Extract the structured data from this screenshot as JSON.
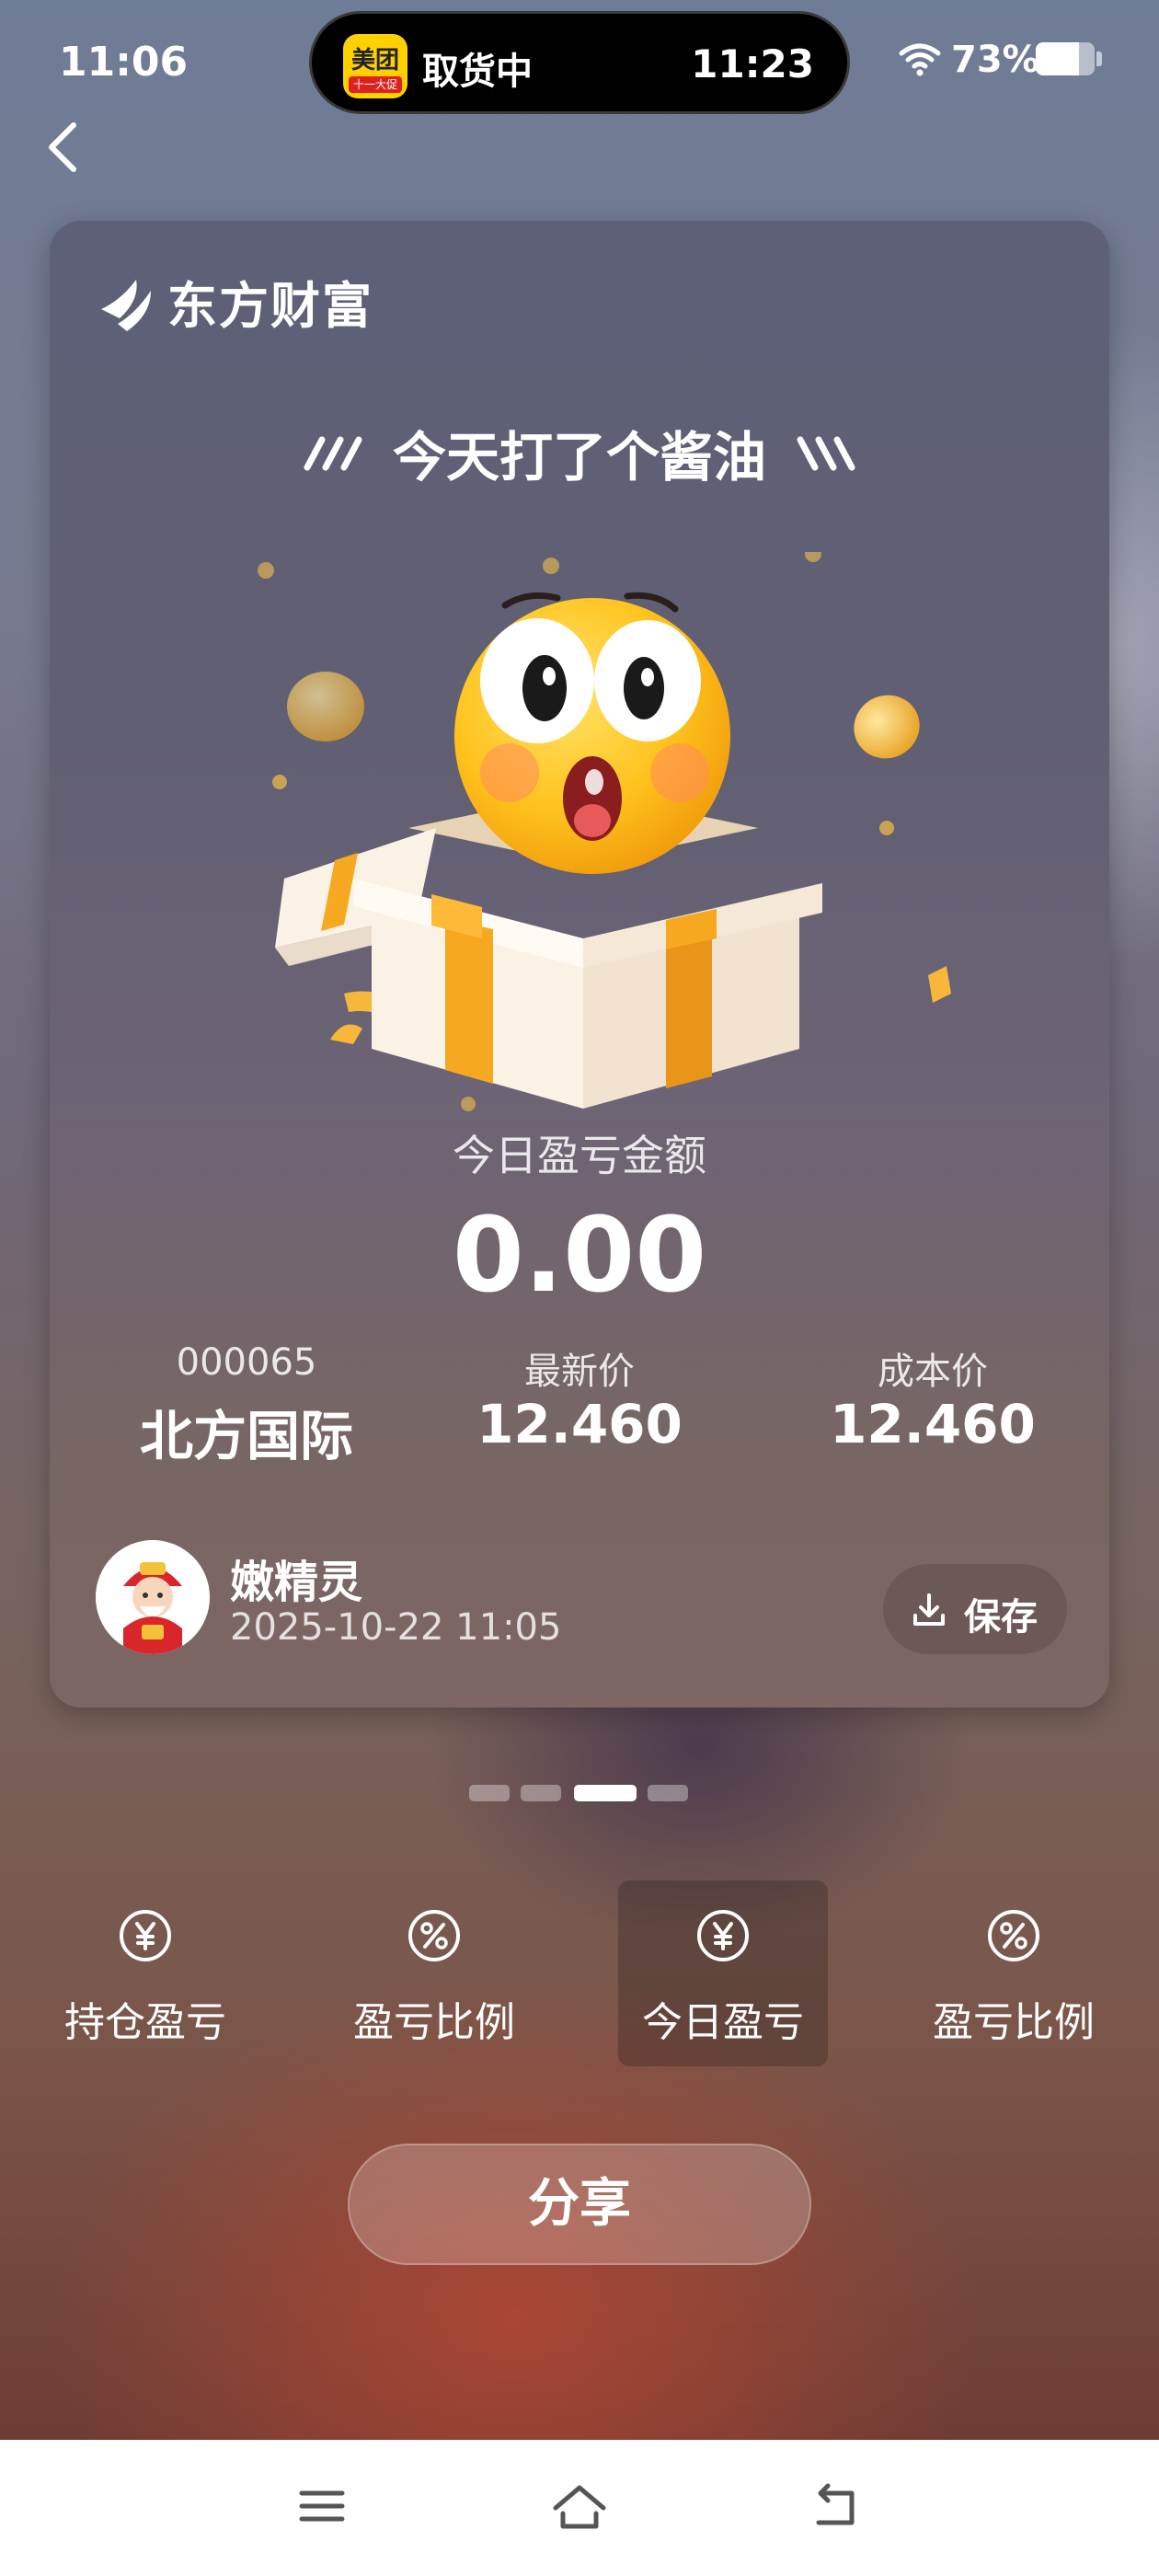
{
  "status_bar": {
    "time": "11:06",
    "island_app_icon_text": "美团",
    "island_app_icon_subtext": "十一大促",
    "island_text": "取货中",
    "island_time": "11:23",
    "battery_percent_label": "73%",
    "battery_level": 0.73
  },
  "card": {
    "brand_name": "东方财富",
    "title": "今天打了个酱油",
    "pl_label": "今日盈亏金额",
    "pl_value": "0.00",
    "stock_code": "000065",
    "stock_name": "北方国际",
    "latest_price_label": "最新价",
    "latest_price": "12.460",
    "cost_price_label": "成本价",
    "cost_price": "12.460",
    "user_name": "嫩精灵",
    "timestamp": "2025-10-22 11:05",
    "save_label": "保存"
  },
  "pager": {
    "count": 4,
    "active_index": 2
  },
  "tabs": [
    {
      "label": "持仓盈亏",
      "icon": "yen-icon"
    },
    {
      "label": "盈亏比例",
      "icon": "percent-icon"
    },
    {
      "label": "今日盈亏",
      "icon": "yen-icon"
    },
    {
      "label": "盈亏比例",
      "icon": "percent-icon"
    }
  ],
  "active_tab_index": 2,
  "share_label": "分享",
  "colors": {
    "accent_gold": "#f6a821",
    "card_top": "#5d6078",
    "card_bottom": "#7d6664"
  }
}
